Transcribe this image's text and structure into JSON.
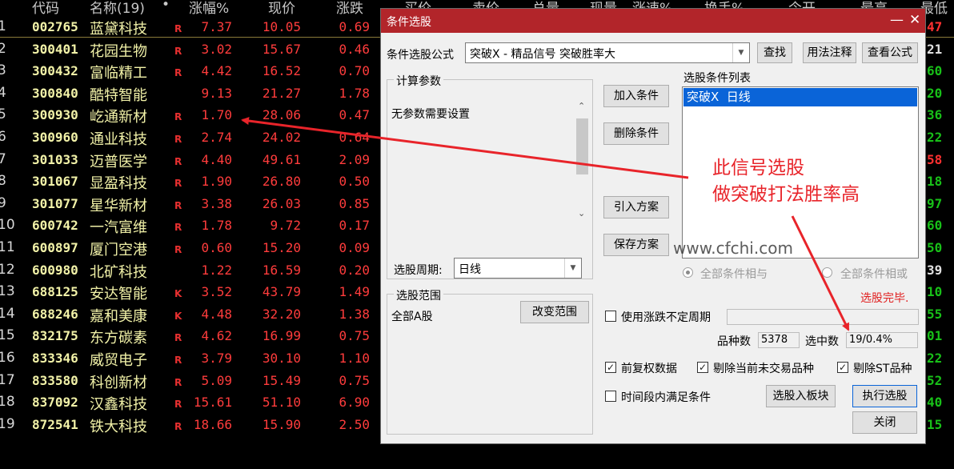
{
  "table": {
    "headers": [
      "代码",
      "名称(19)",
      "•",
      "涨幅%",
      "现价",
      "涨跌",
      "买价",
      "卖价",
      "总量",
      "现量",
      "涨速%",
      "换手%",
      "今开",
      "最高",
      "最低"
    ],
    "rows": [
      {
        "idx": "1",
        "code": "002765",
        "name": "蓝黛科技",
        "flag": "R",
        "pct": "7.37",
        "price": "10.05",
        "chg": "0.69",
        "edge": "47",
        "edgeColor": "red"
      },
      {
        "idx": "2",
        "code": "300401",
        "name": "花园生物",
        "flag": "R",
        "pct": "3.02",
        "price": "15.67",
        "chg": "0.46",
        "edge": "21",
        "edgeColor": "wht"
      },
      {
        "idx": "3",
        "code": "300432",
        "name": "富临精工",
        "flag": "R",
        "pct": "4.42",
        "price": "16.52",
        "chg": "0.70",
        "edge": "60",
        "edgeColor": "green"
      },
      {
        "idx": "4",
        "code": "300840",
        "name": "酷特智能",
        "flag": "",
        "pct": "9.13",
        "price": "21.27",
        "chg": "1.78",
        "edge": "20",
        "edgeColor": "green"
      },
      {
        "idx": "5",
        "code": "300930",
        "name": "屹通新材",
        "flag": "R",
        "pct": "1.70",
        "price": "28.06",
        "chg": "0.47",
        "edge": "36",
        "edgeColor": "green"
      },
      {
        "idx": "6",
        "code": "300960",
        "name": "通业科技",
        "flag": "R",
        "pct": "2.74",
        "price": "24.02",
        "chg": "0.64",
        "edge": "22",
        "edgeColor": "green"
      },
      {
        "idx": "7",
        "code": "301033",
        "name": "迈普医学",
        "flag": "R",
        "pct": "4.40",
        "price": "49.61",
        "chg": "2.09",
        "edge": "58",
        "edgeColor": "red"
      },
      {
        "idx": "8",
        "code": "301067",
        "name": "显盈科技",
        "flag": "R",
        "pct": "1.90",
        "price": "26.80",
        "chg": "0.50",
        "edge": "18",
        "edgeColor": "green"
      },
      {
        "idx": "9",
        "code": "301077",
        "name": "星华新材",
        "flag": "R",
        "pct": "3.38",
        "price": "26.03",
        "chg": "0.85",
        "edge": "97",
        "edgeColor": "green"
      },
      {
        "idx": "10",
        "code": "600742",
        "name": "一汽富维",
        "flag": "R",
        "pct": "1.78",
        "price": "9.72",
        "chg": "0.17",
        "edge": "60",
        "edgeColor": "green"
      },
      {
        "idx": "11",
        "code": "600897",
        "name": "厦门空港",
        "flag": "R",
        "pct": "0.60",
        "price": "15.20",
        "chg": "0.09",
        "edge": "50",
        "edgeColor": "green"
      },
      {
        "idx": "12",
        "code": "600980",
        "name": "北矿科技",
        "flag": "",
        "pct": "1.22",
        "price": "16.59",
        "chg": "0.20",
        "edge": "39",
        "edgeColor": "wht"
      },
      {
        "idx": "13",
        "code": "688125",
        "name": "安达智能",
        "flag": "K",
        "pct": "3.52",
        "price": "43.79",
        "chg": "1.49",
        "edge": "10",
        "edgeColor": "green"
      },
      {
        "idx": "14",
        "code": "688246",
        "name": "嘉和美康",
        "flag": "K",
        "pct": "4.48",
        "price": "32.20",
        "chg": "1.38",
        "edge": "55",
        "edgeColor": "green"
      },
      {
        "idx": "15",
        "code": "832175",
        "name": "东方碳素",
        "flag": "R",
        "pct": "4.62",
        "price": "16.99",
        "chg": "0.75",
        "edge": "01",
        "edgeColor": "green"
      },
      {
        "idx": "16",
        "code": "833346",
        "name": "威贸电子",
        "flag": "R",
        "pct": "3.79",
        "price": "30.10",
        "chg": "1.10",
        "edge": "22",
        "edgeColor": "green"
      },
      {
        "idx": "17",
        "code": "833580",
        "name": "科创新材",
        "flag": "R",
        "pct": "5.09",
        "price": "15.49",
        "chg": "0.75",
        "edge": "52",
        "edgeColor": "green"
      },
      {
        "idx": "18",
        "code": "837092",
        "name": "汉鑫科技",
        "flag": "R",
        "pct": "15.61",
        "price": "51.10",
        "chg": "6.90",
        "edge": "40",
        "edgeColor": "green"
      },
      {
        "idx": "19",
        "code": "872541",
        "name": "铁大科技",
        "flag": "R",
        "pct": "18.66",
        "price": "15.90",
        "chg": "2.50",
        "edge": "15",
        "edgeColor": "green"
      }
    ]
  },
  "dialog": {
    "title": "条件选股",
    "minimize": "—",
    "close_x": "✕",
    "formula_label": "条件选股公式",
    "formula_value": "突破X  -  精品信号  突破胜率大",
    "find_btn": "查找",
    "usage_btn": "用法注释",
    "view_btn": "查看公式",
    "params_title": "计算参数",
    "params_text": "无参数需要设置",
    "period_label": "选股周期:",
    "period_value": "日线",
    "add_btn": "加入条件",
    "del_btn": "删除条件",
    "import_btn": "引入方案",
    "save_btn": "保存方案",
    "cond_list_title": "选股条件列表",
    "cond_items": [
      "突破X  日线"
    ],
    "radio_and": "全部条件相与",
    "radio_or": "全部条件相或",
    "done_text": "选股完毕.",
    "range_title": "选股范围",
    "range_value": "全部A股",
    "range_btn": "改变范围",
    "use_var_period": "使用涨跌不定周期",
    "count_label": "品种数",
    "count_value": "5378",
    "selected_label": "选中数",
    "selected_value": "19/0.4%",
    "opt_fq": "前复权数据",
    "opt_exclude_untraded": "剔除当前未交易品种",
    "opt_exclude_st": "剔除ST品种",
    "opt_period_satisfy": "时间段内满足条件",
    "to_board_btn": "选股入板块",
    "run_btn": "执行选股",
    "close_btn": "关闭"
  },
  "annotation": {
    "line1": "此信号选股",
    "line2": "做突破打法胜率高",
    "watermark": "www.cfchi.com",
    "color": "#e8242a"
  }
}
